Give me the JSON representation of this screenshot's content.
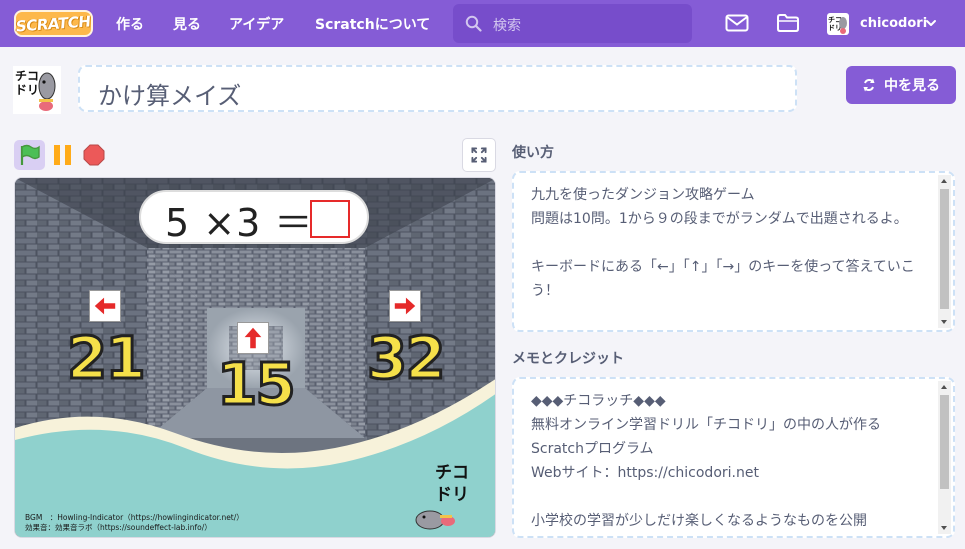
{
  "header": {
    "logo_text": "SCRATCH",
    "nav": [
      {
        "label": "作る"
      },
      {
        "label": "見る"
      },
      {
        "label": "アイデア"
      },
      {
        "label": "Scratchについて"
      }
    ],
    "search_placeholder": "検索",
    "username": "chicodori"
  },
  "project": {
    "title": "かけ算メイズ",
    "see_inside_label": "中を見る"
  },
  "stage": {
    "question": "5 ×3 ＝",
    "left_choice": "21",
    "center_choice": "15",
    "right_choice": "32",
    "left_arrow": "←",
    "center_arrow": "↑",
    "right_arrow": "→",
    "credit_bgm": "BGM　：Howling-Indicator（https://howlingindicator.net/）",
    "credit_se": "効果音：効果音ラボ（https://soundeffect-lab.info/）",
    "brand_mark": "チコドリ"
  },
  "instructions": {
    "heading": "使い方",
    "text": "九九を使ったダンジョン攻略ゲーム\n問題は10問。1から９の段までがランダムで出題されるよ。\n\nキーボードにある「←」「↑」「→」のキーを使って答えていこう！"
  },
  "notes": {
    "heading": "メモとクレジット",
    "text": "◆◆◆チコラッチ◆◆◆\n無料オンライン学習ドリル「チコドリ」の中の人が作るScratchプログラム\nWebサイト：https://chicodori.net\n\n小学校の学習が少しだけ楽しくなるようなものを公開"
  },
  "colors": {
    "brand_purple": "#855cd6",
    "text_gray": "#575e75",
    "flag_green": "#4cbf56",
    "stop_red": "#ec5959",
    "pause_yellow": "#ffab19"
  }
}
